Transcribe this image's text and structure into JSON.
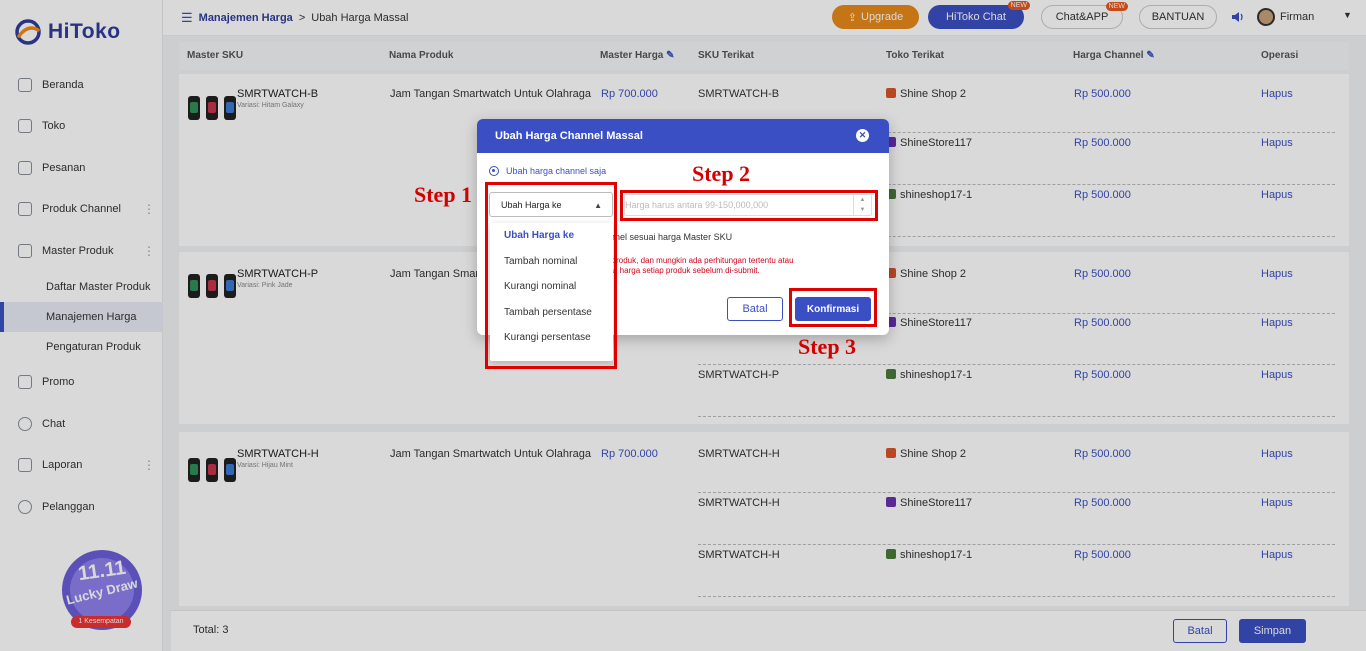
{
  "app": {
    "name": "HiToko"
  },
  "sidebar": {
    "items": [
      {
        "label": "Beranda",
        "icon": "monitor-icon"
      },
      {
        "label": "Toko",
        "icon": "store-icon"
      },
      {
        "label": "Pesanan",
        "icon": "orders-icon"
      },
      {
        "label": "Produk Channel",
        "icon": "grid-icon"
      },
      {
        "label": "Master Produk",
        "icon": "box-icon"
      }
    ],
    "sub_items": [
      "Daftar Master Produk",
      "Manajemen Harga",
      "Pengaturan Produk"
    ],
    "items_after": [
      {
        "label": "Promo",
        "icon": "promo-icon"
      },
      {
        "label": "Chat",
        "icon": "chat-icon"
      },
      {
        "label": "Laporan",
        "icon": "report-icon"
      },
      {
        "label": "Pelanggan",
        "icon": "users-icon"
      }
    ],
    "promo": {
      "line1": "11.11",
      "line2": "Lucky Draw",
      "badge": "1 Kesempatan"
    }
  },
  "header": {
    "breadcrumb_parent": "Manajemen Harga",
    "breadcrumb_sep": ">",
    "breadcrumb_current": "Ubah Harga Massal",
    "upgrade": "Upgrade",
    "hitoko_chat": "HiToko Chat",
    "chat_app": "Chat&APP",
    "bantuan": "BANTUAN",
    "new_tag": "NEW",
    "user_name": "Firman"
  },
  "table": {
    "columns": [
      "Master SKU",
      "Nama Produk",
      "Master Harga",
      "SKU Terikat",
      "Toko Terikat",
      "Harga Channel",
      "Operasi"
    ],
    "groups": [
      {
        "sku": "SMRTWATCH-B",
        "variant": "Variasi: Hitam Galaxy",
        "product": "Jam Tangan Smartwatch Untuk Olahraga",
        "master_price": "Rp 700.000",
        "rows": [
          {
            "sku": "SMRTWATCH-B",
            "shop": "Shine Shop 2",
            "price": "Rp 500.000",
            "op": "Hapus"
          },
          {
            "sku": "",
            "shop": "ShineStore117",
            "price": "Rp 500.000",
            "op": "Hapus"
          },
          {
            "sku": "",
            "shop": "shineshop17-1",
            "price": "Rp 500.000",
            "op": "Hapus"
          }
        ]
      },
      {
        "sku": "SMRTWATCH-P",
        "variant": "Variasi: Pink Jade",
        "product": "Jam Tangan Smart",
        "master_price": "",
        "rows": [
          {
            "sku": "",
            "shop": "Shine Shop 2",
            "price": "Rp 500.000",
            "op": "Hapus"
          },
          {
            "sku": "",
            "shop": "ShineStore117",
            "price": "Rp 500.000",
            "op": "Hapus"
          },
          {
            "sku": "SMRTWATCH-P",
            "shop": "shineshop17-1",
            "price": "Rp 500.000",
            "op": "Hapus"
          }
        ]
      },
      {
        "sku": "SMRTWATCH-H",
        "variant": "Variasi: Hijau Mint",
        "product": "Jam Tangan Smartwatch Untuk Olahraga",
        "master_price": "Rp 700.000",
        "rows": [
          {
            "sku": "SMRTWATCH-H",
            "shop": "Shine Shop 2",
            "price": "Rp 500.000",
            "op": "Hapus"
          },
          {
            "sku": "SMRTWATCH-H",
            "shop": "ShineStore117",
            "price": "Rp 500.000",
            "op": "Hapus"
          },
          {
            "sku": "SMRTWATCH-H",
            "shop": "shineshop17-1",
            "price": "Rp 500.000",
            "op": "Hapus"
          }
        ]
      }
    ]
  },
  "footer": {
    "total": "Total: 3",
    "batal": "Batal",
    "simpan": "Simpan"
  },
  "modal": {
    "title": "Ubah Harga Channel Massal",
    "radio_label": "Ubah harga channel saja",
    "select_value": "Ubah Harga ke",
    "input_placeholder": "Harga harus antara 99-150,000,000",
    "text1": "annel sesuai harga Master SKU",
    "warn_line1": "a produk, dan mungkin ada perhitungan tertentu atau",
    "warn_line2": "bali harga setiap produk sebelum di-submit.",
    "batal": "Batal",
    "konfirmasi": "Konfirmasi"
  },
  "dropdown": {
    "options": [
      "Ubah Harga ke",
      "Tambah nominal",
      "Kurangi nominal",
      "Tambah persentase",
      "Kurangi persentase"
    ],
    "selected": "Ubah Harga ke"
  },
  "annotations": {
    "step1": "Step 1",
    "step2": "Step 2",
    "step3": "Step 3"
  },
  "colors": {
    "primary": "#3b4fc4",
    "upgrade": "#e8891a",
    "highlight": "#e00000"
  }
}
